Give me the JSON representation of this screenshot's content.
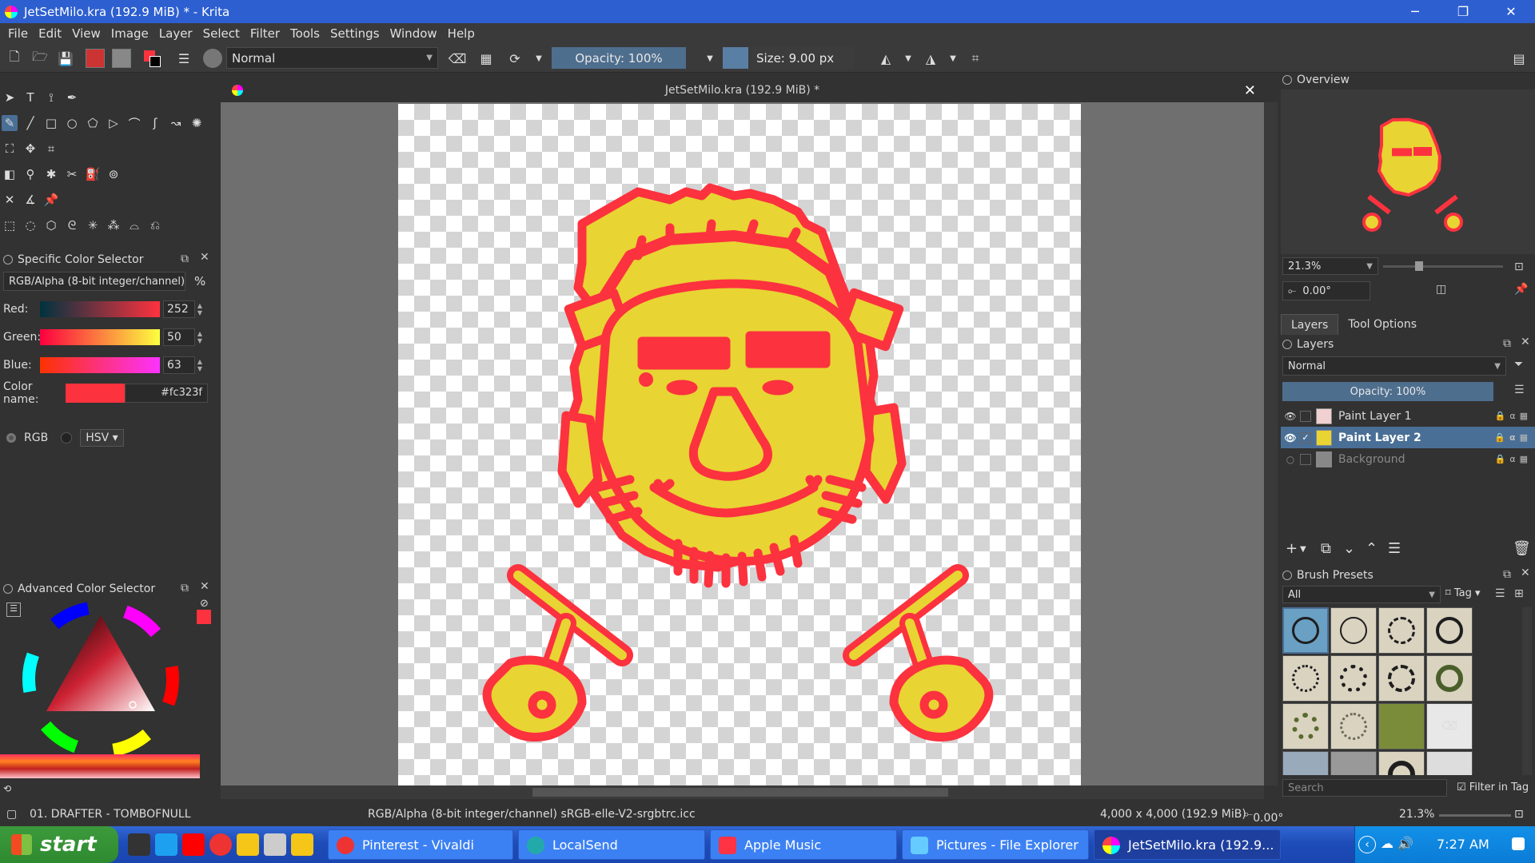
{
  "window": {
    "title": "JetSetMilo.kra (192.9 MiB) * - Krita",
    "minimize": "─",
    "restore": "❐",
    "close": "✕"
  },
  "menu": [
    "File",
    "Edit",
    "View",
    "Image",
    "Layer",
    "Select",
    "Filter",
    "Tools",
    "Settings",
    "Window",
    "Help"
  ],
  "toolbar": {
    "blend_mode": "Normal",
    "opacity": "Opacity: 100%",
    "size": "Size: 9.00 px"
  },
  "document": {
    "tab_title": "JetSetMilo.kra (192.9 MiB) *",
    "close": "✕"
  },
  "specific_color_selector": {
    "title": "Specific Color Selector",
    "model": "RGB/Alpha (8-bit integer/channel)",
    "percent": "%",
    "red_label": "Red:",
    "red_value": "252",
    "green_label": "Green:",
    "green_value": "50",
    "blue_label": "Blue:",
    "blue_value": "63",
    "color_name_label": "Color name:",
    "color_hex": "#fc323f",
    "swatch_color": "#fc323f",
    "rgb_label": "RGB",
    "hsv_label": "HSV"
  },
  "advanced_color_selector": {
    "title": "Advanced Color Selector"
  },
  "overview": {
    "title": "Overview",
    "zoom": "21.3%",
    "rotation": "0.00°"
  },
  "right_tabs": [
    "Layers",
    "Tool Options"
  ],
  "layers": {
    "title": "Layers",
    "blend_mode": "Normal",
    "opacity": "Opacity: 100%",
    "items": [
      {
        "name": "Paint Layer 1",
        "selected": false,
        "visible": true
      },
      {
        "name": "Paint Layer 2",
        "selected": true,
        "visible": true
      },
      {
        "name": "Background",
        "selected": false,
        "visible": false
      }
    ]
  },
  "brush_presets": {
    "title": "Brush Presets",
    "filter": "All",
    "tag": "Tag",
    "search_placeholder": "Search",
    "filter_in_tag": "Filter in Tag"
  },
  "status": {
    "brush": "01. DRAFTER - TOMBOFNULL",
    "color_space": "RGB/Alpha (8-bit integer/channel)  sRGB-elle-V2-srgbtrc.icc",
    "dimensions": "4,000 x 4,000 (192.9 MiB)",
    "rotation": "0.00°",
    "zoom": "21.3%"
  },
  "taskbar": {
    "start": "start",
    "tasks": [
      {
        "label": "Pinterest - Vivaldi",
        "active": false
      },
      {
        "label": "LocalSend",
        "active": false
      },
      {
        "label": "Apple Music",
        "active": false
      },
      {
        "label": "Pictures - File Explorer",
        "active": false
      },
      {
        "label": "JetSetMilo.kra (192.9...",
        "active": true
      }
    ],
    "clock": "7:27 AM"
  },
  "colors": {
    "accent": "#4a6f96",
    "art_red": "#fc323f",
    "art_yellow": "#e8d432",
    "titlebar": "#2d5fd0"
  }
}
